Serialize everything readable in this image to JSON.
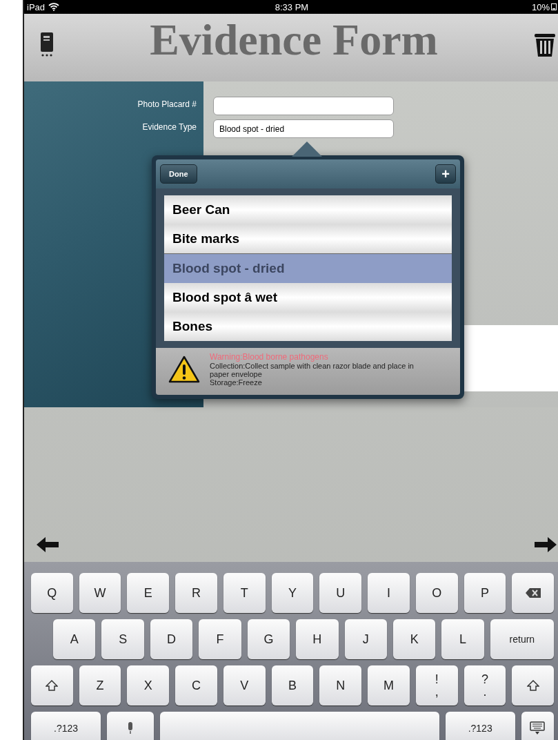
{
  "status_bar": {
    "device": "iPad",
    "time": "8:33 PM",
    "battery": "10%"
  },
  "header": {
    "title": "Evidence Form"
  },
  "form": {
    "fields": [
      {
        "label": "Photo Placard #"
      },
      {
        "label": "Evidence Type",
        "value": "Blood spot - dried"
      }
    ]
  },
  "popover": {
    "done": "Done",
    "add": "+",
    "picker": [
      {
        "label": "Beer Can",
        "selected": false
      },
      {
        "label": "Bite marks",
        "selected": false
      },
      {
        "label": "Blood spot - dried",
        "selected": true
      },
      {
        "label": "Blood spot â wet",
        "selected": false
      },
      {
        "label": "Bones",
        "selected": false
      }
    ],
    "info": {
      "warning": "Warning:Blood borne pathogens",
      "lines": [
        "Collection:Collect sample with clean razor blade and place in paper envelope",
        "Storage:Freeze"
      ]
    }
  },
  "keyboard": {
    "rows": [
      {
        "keys": [
          {
            "kind": "char",
            "label": "Q"
          },
          {
            "kind": "char",
            "label": "W"
          },
          {
            "kind": "char",
            "label": "E"
          },
          {
            "kind": "char",
            "label": "R"
          },
          {
            "kind": "char",
            "label": "T"
          },
          {
            "kind": "char",
            "label": "Y"
          },
          {
            "kind": "char",
            "label": "U"
          },
          {
            "kind": "char",
            "label": "I"
          },
          {
            "kind": "char",
            "label": "O"
          },
          {
            "kind": "char",
            "label": "P"
          },
          {
            "kind": "backspace"
          }
        ]
      },
      {
        "keys": [
          {
            "kind": "char",
            "label": "A"
          },
          {
            "kind": "char",
            "label": "S"
          },
          {
            "kind": "char",
            "label": "D"
          },
          {
            "kind": "char",
            "label": "F"
          },
          {
            "kind": "char",
            "label": "G"
          },
          {
            "kind": "char",
            "label": "H"
          },
          {
            "kind": "char",
            "label": "J"
          },
          {
            "kind": "char",
            "label": "K"
          },
          {
            "kind": "char",
            "label": "L"
          },
          {
            "kind": "wide",
            "label": "return"
          }
        ]
      },
      {
        "keys": [
          {
            "kind": "shift"
          },
          {
            "kind": "char",
            "label": "Z"
          },
          {
            "kind": "char",
            "label": "X"
          },
          {
            "kind": "char",
            "label": "C"
          },
          {
            "kind": "char",
            "label": "V"
          },
          {
            "kind": "char",
            "label": "B"
          },
          {
            "kind": "char",
            "label": "N"
          },
          {
            "kind": "char",
            "label": "M"
          },
          {
            "kind": "dual",
            "label": "!",
            "lower": ","
          },
          {
            "kind": "dual",
            "label": "?",
            "lower": "."
          },
          {
            "kind": "shift"
          }
        ]
      },
      {
        "keys": [
          {
            "kind": "wide",
            "label": ".?123"
          },
          {
            "kind": "mic"
          },
          {
            "kind": "space"
          },
          {
            "kind": "wide",
            "label": ".?123"
          },
          {
            "kind": "hide"
          }
        ]
      }
    ]
  }
}
